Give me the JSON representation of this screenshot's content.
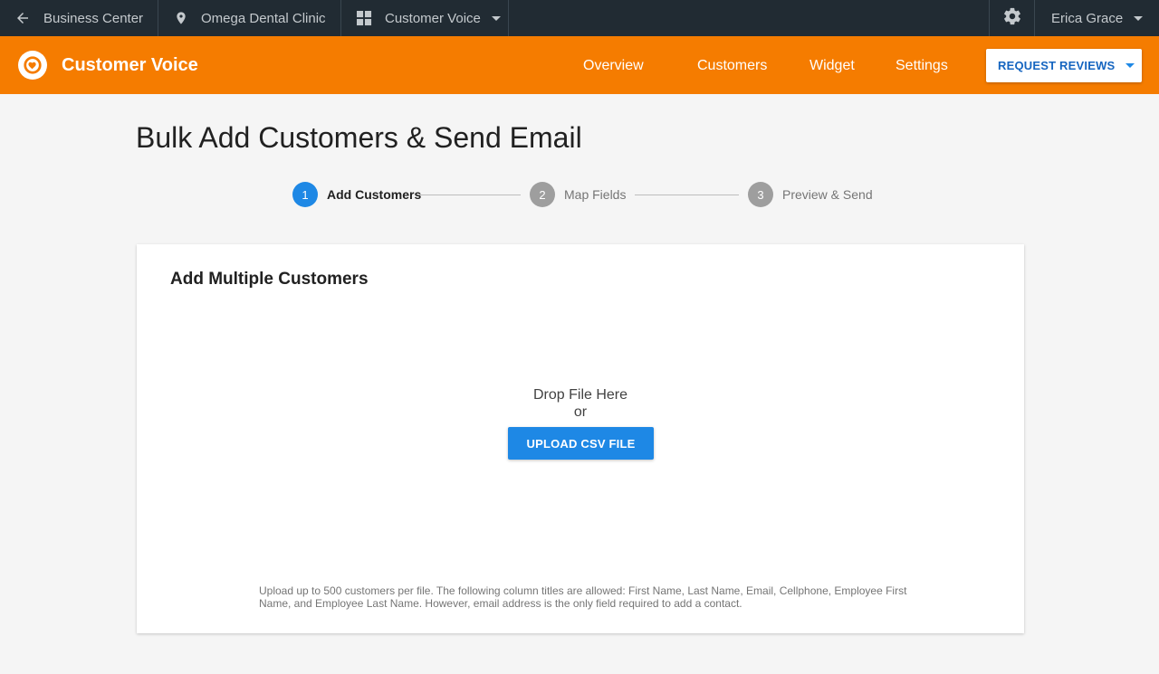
{
  "topbar": {
    "back_label": "Business Center",
    "location_label": "Omega Dental Clinic",
    "app_label": "Customer Voice",
    "user_name": "Erica Grace"
  },
  "appbar": {
    "title": "Customer Voice",
    "nav": [
      "Overview",
      "Customers",
      "Widget",
      "Settings"
    ],
    "request_button": "REQUEST REVIEWS",
    "brand_color": "#f57c00"
  },
  "page": {
    "title": "Bulk Add Customers & Send Email"
  },
  "stepper": {
    "steps": [
      {
        "number": "1",
        "label": "Add Customers",
        "active": true
      },
      {
        "number": "2",
        "label": "Map Fields",
        "active": false
      },
      {
        "number": "3",
        "label": "Preview & Send",
        "active": false
      }
    ],
    "active_color": "#1e88e5",
    "inactive_color": "#9e9e9e"
  },
  "card": {
    "title": "Add Multiple Customers",
    "drop_text": "Drop File Here",
    "or_text": "or",
    "upload_button": "UPLOAD CSV FILE",
    "hint": "Upload up to 500 customers per file. The following column titles are allowed: First Name, Last Name, Email, Cellphone, Employee First Name, and Employee Last Name. However, email address is the only field required to add a contact."
  },
  "icons": {
    "back": "arrow-left-icon",
    "location": "map-pin-icon",
    "app": "grid-icon",
    "settings": "gear-icon",
    "logo": "heart-icon"
  }
}
